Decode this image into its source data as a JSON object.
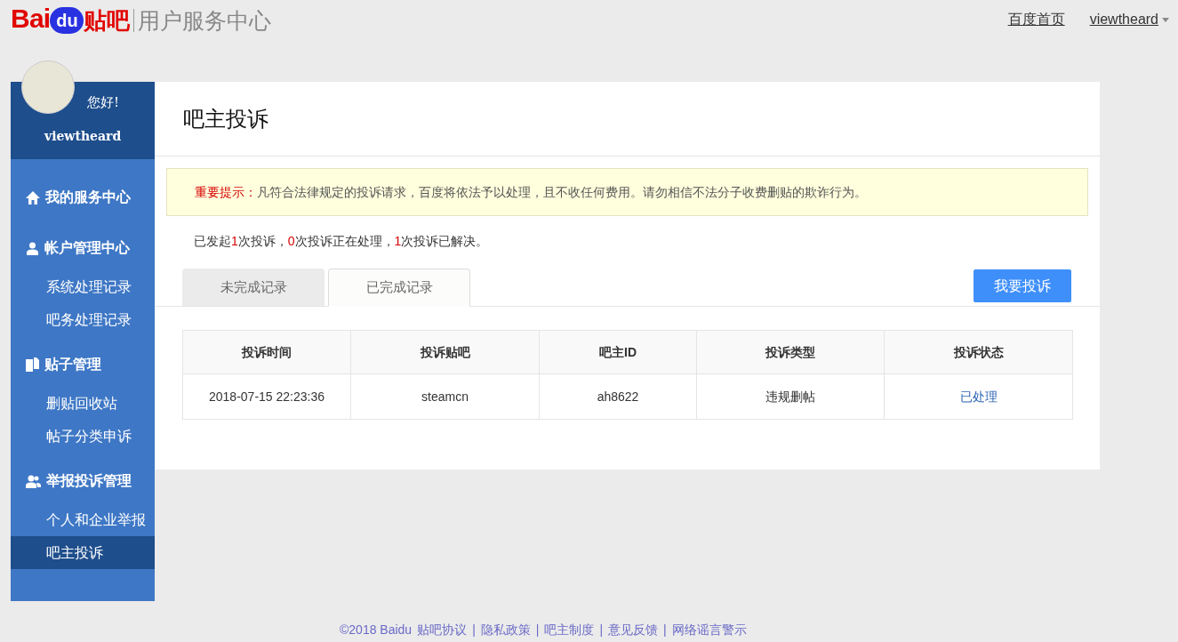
{
  "logo": {
    "brand_left": "Bai",
    "brand_badge": "du",
    "brand_right": "贴吧",
    "subtitle": "用户服务中心"
  },
  "top_nav": {
    "home_link": "百度首页",
    "user_menu": "viewtheard"
  },
  "sidebar": {
    "greeting": "您好!",
    "username": "viewtheard",
    "sections": [
      {
        "label": "我的服务中心"
      },
      {
        "label": "帐户管理中心",
        "children": [
          {
            "label": "系统处理记录",
            "selected": false
          },
          {
            "label": "吧务处理记录",
            "selected": false
          }
        ]
      },
      {
        "label": "贴子管理",
        "children": [
          {
            "label": "删贴回收站",
            "selected": false
          },
          {
            "label": "帖子分类申诉",
            "selected": false
          }
        ]
      },
      {
        "label": "举报投诉管理",
        "children": [
          {
            "label": "个人和企业举报",
            "selected": false
          },
          {
            "label": "吧主投诉",
            "selected": true
          }
        ]
      }
    ]
  },
  "main": {
    "title": "吧主投诉",
    "notice": {
      "label": "重要提示：",
      "text": "凡符合法律规定的投诉请求，百度将依法予以处理，且不收任何费用。请勿相信不法分子收费删贴的欺诈行为。"
    },
    "summary": [
      {
        "text": "已发起",
        "highlight": false
      },
      {
        "text": "1",
        "highlight": true
      },
      {
        "text": "次投诉，",
        "highlight": false
      },
      {
        "text": "0",
        "highlight": true
      },
      {
        "text": "次投诉正在处理，",
        "highlight": false
      },
      {
        "text": "1",
        "highlight": true
      },
      {
        "text": "次投诉已解决。",
        "highlight": false
      }
    ],
    "tabs": [
      {
        "label": "未完成记录",
        "selected": false
      },
      {
        "label": "已完成记录",
        "selected": true
      }
    ],
    "action_button": "我要投诉",
    "table": {
      "columns": [
        "投诉时间",
        "投诉贴吧",
        "吧主ID",
        "投诉类型",
        "投诉状态"
      ],
      "rows": [
        {
          "cells": [
            "2018-07-15 22:23:36",
            "steamcn",
            "ah8622",
            "违规删帖",
            "已处理"
          ]
        }
      ]
    }
  },
  "footer": {
    "copyright": "©2018 Baidu",
    "separator": "|",
    "links": [
      "贴吧协议",
      "隐私政策",
      "吧主制度",
      "意见反馈",
      "网络谣言警示"
    ]
  }
}
